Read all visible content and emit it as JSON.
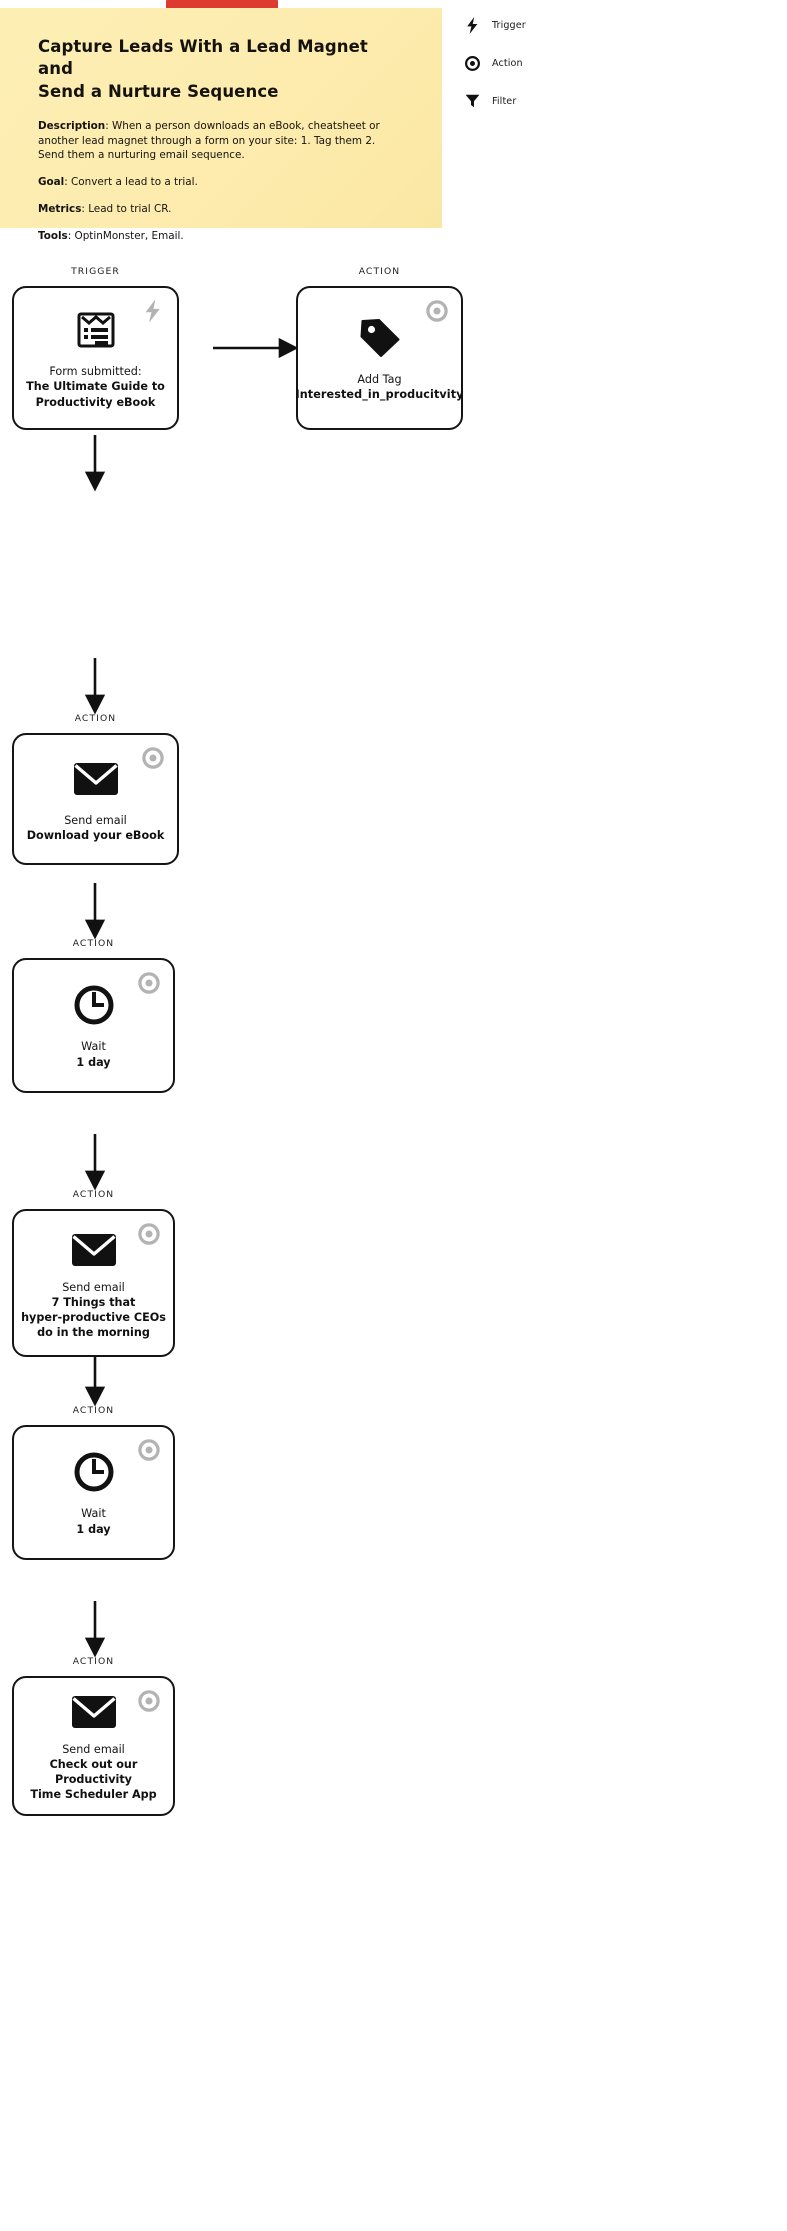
{
  "note": {
    "title": "Capture Leads With a Lead Magnet and\nSend a Nurture Sequence",
    "description_label": "Description",
    "description_text": ": When a person downloads an eBook, cheatsheet or another lead magnet through a form on your site: 1. Tag them 2. Send them a nurturing email sequence.",
    "goal_label": "Goal",
    "goal_text": ": Convert a lead to a trial.",
    "metrics_label": "Metrics",
    "metrics_text": ": Lead to trial CR.",
    "tools_label": "Tools",
    "tools_text": ": OptinMonster, Email.",
    "accent_color": "#fdecae",
    "tape_color": "#dd3b30"
  },
  "legend": {
    "items": [
      {
        "label": "Trigger",
        "icon": "lightning-bolt-icon"
      },
      {
        "label": "Action",
        "icon": "circle-dot-icon"
      },
      {
        "label": "Filter",
        "icon": "funnel-icon"
      }
    ]
  },
  "flow": {
    "nodes": [
      {
        "kind": "TRIGGER",
        "badge": "lightning-bolt-icon",
        "icon": "form-icon",
        "line1": "Form submitted:",
        "line2": "The Ultimate Guide to\nProductivity eBook"
      },
      {
        "kind": "ACTION",
        "badge": "circle-dot-icon",
        "icon": "tag-icon",
        "line1": "Add Tag",
        "line2": "Interested_in_producitvity"
      },
      {
        "kind": "ACTION",
        "badge": "circle-dot-icon",
        "icon": "envelope-icon",
        "line1": "Send email",
        "line2": "Download your eBook"
      },
      {
        "kind": "ACTION",
        "badge": "circle-dot-icon",
        "icon": "clock-icon",
        "line1": "Wait",
        "line2": "1 day"
      },
      {
        "kind": "ACTION",
        "badge": "circle-dot-icon",
        "icon": "envelope-icon",
        "line1": "Send email",
        "line2": "7 Things that\nhyper-productive CEOs\ndo in the morning"
      },
      {
        "kind": "ACTION",
        "badge": "circle-dot-icon",
        "icon": "clock-icon",
        "line1": "Wait",
        "line2": "1 day"
      },
      {
        "kind": "ACTION",
        "badge": "circle-dot-icon",
        "icon": "envelope-icon",
        "line1": "Send email",
        "line2": "Check out our Productivity\nTime Scheduler App"
      }
    ]
  }
}
